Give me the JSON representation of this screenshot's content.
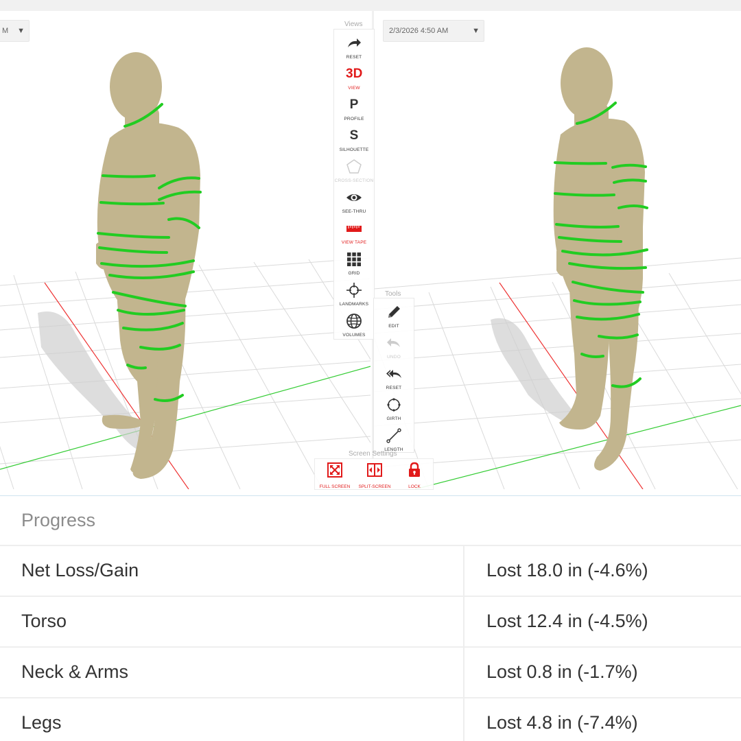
{
  "left_view": {
    "date_value": "M"
  },
  "right_view": {
    "date_value": "2/3/2026 4:50 AM"
  },
  "views_panel": {
    "title": "Views",
    "items": [
      {
        "label": "RESET",
        "icon": "redo-arrow-icon",
        "active": false
      },
      {
        "label": "VIEW",
        "glyph": "3D",
        "icon": "3d-view-icon",
        "active": true
      },
      {
        "label": "PROFILE",
        "glyph": "P",
        "icon": "profile-icon",
        "active": false
      },
      {
        "label": "SILHOUETTE",
        "glyph": "S",
        "icon": "silhouette-icon",
        "active": false
      },
      {
        "label": "CROSS-SECTION",
        "icon": "pentagon-icon",
        "disabled": true
      },
      {
        "label": "SEE-THRU",
        "icon": "eye-icon",
        "active": false
      },
      {
        "label": "VIEW TAPE",
        "icon": "tape-measure-icon",
        "active": true
      },
      {
        "label": "GRID",
        "icon": "grid-icon",
        "active": false
      },
      {
        "label": "LANDMARKS",
        "icon": "crosshair-icon",
        "active": false
      },
      {
        "label": "VOLUMES",
        "icon": "globe-icon",
        "active": false
      }
    ]
  },
  "tools_panel": {
    "title": "Tools",
    "items": [
      {
        "label": "EDIT",
        "icon": "pencil-icon"
      },
      {
        "label": "UNDO",
        "icon": "undo-arrow-icon",
        "disabled": true
      },
      {
        "label": "RESET",
        "icon": "double-back-arrow-icon"
      },
      {
        "label": "GIRTH",
        "icon": "girth-circle-icon"
      },
      {
        "label": "LENGTH",
        "icon": "length-ruler-icon"
      }
    ]
  },
  "screen_settings": {
    "title": "Screen Settings",
    "items": [
      {
        "label": "FULL SCREEN",
        "icon": "full-screen-icon"
      },
      {
        "label": "SPLIT-SCREEN",
        "icon": "split-screen-icon"
      },
      {
        "label": "LOCK",
        "icon": "lock-icon"
      }
    ]
  },
  "progress": {
    "title": "Progress",
    "rows": [
      {
        "name": "Net Loss/Gain",
        "value": "Lost 18.0 in (-4.6%)"
      },
      {
        "name": "Torso",
        "value": "Lost 12.4 in (-4.5%)"
      },
      {
        "name": "Neck & Arms",
        "value": "Lost 0.8 in (-1.7%)"
      },
      {
        "name": "Legs",
        "value": "Lost 4.8 in (-7.4%)"
      }
    ]
  },
  "colors": {
    "accent_red": "#e11a1a",
    "tape_green": "#22cc22",
    "body_skin": "#c2b58e",
    "grid_line": "#d8d8d8"
  }
}
